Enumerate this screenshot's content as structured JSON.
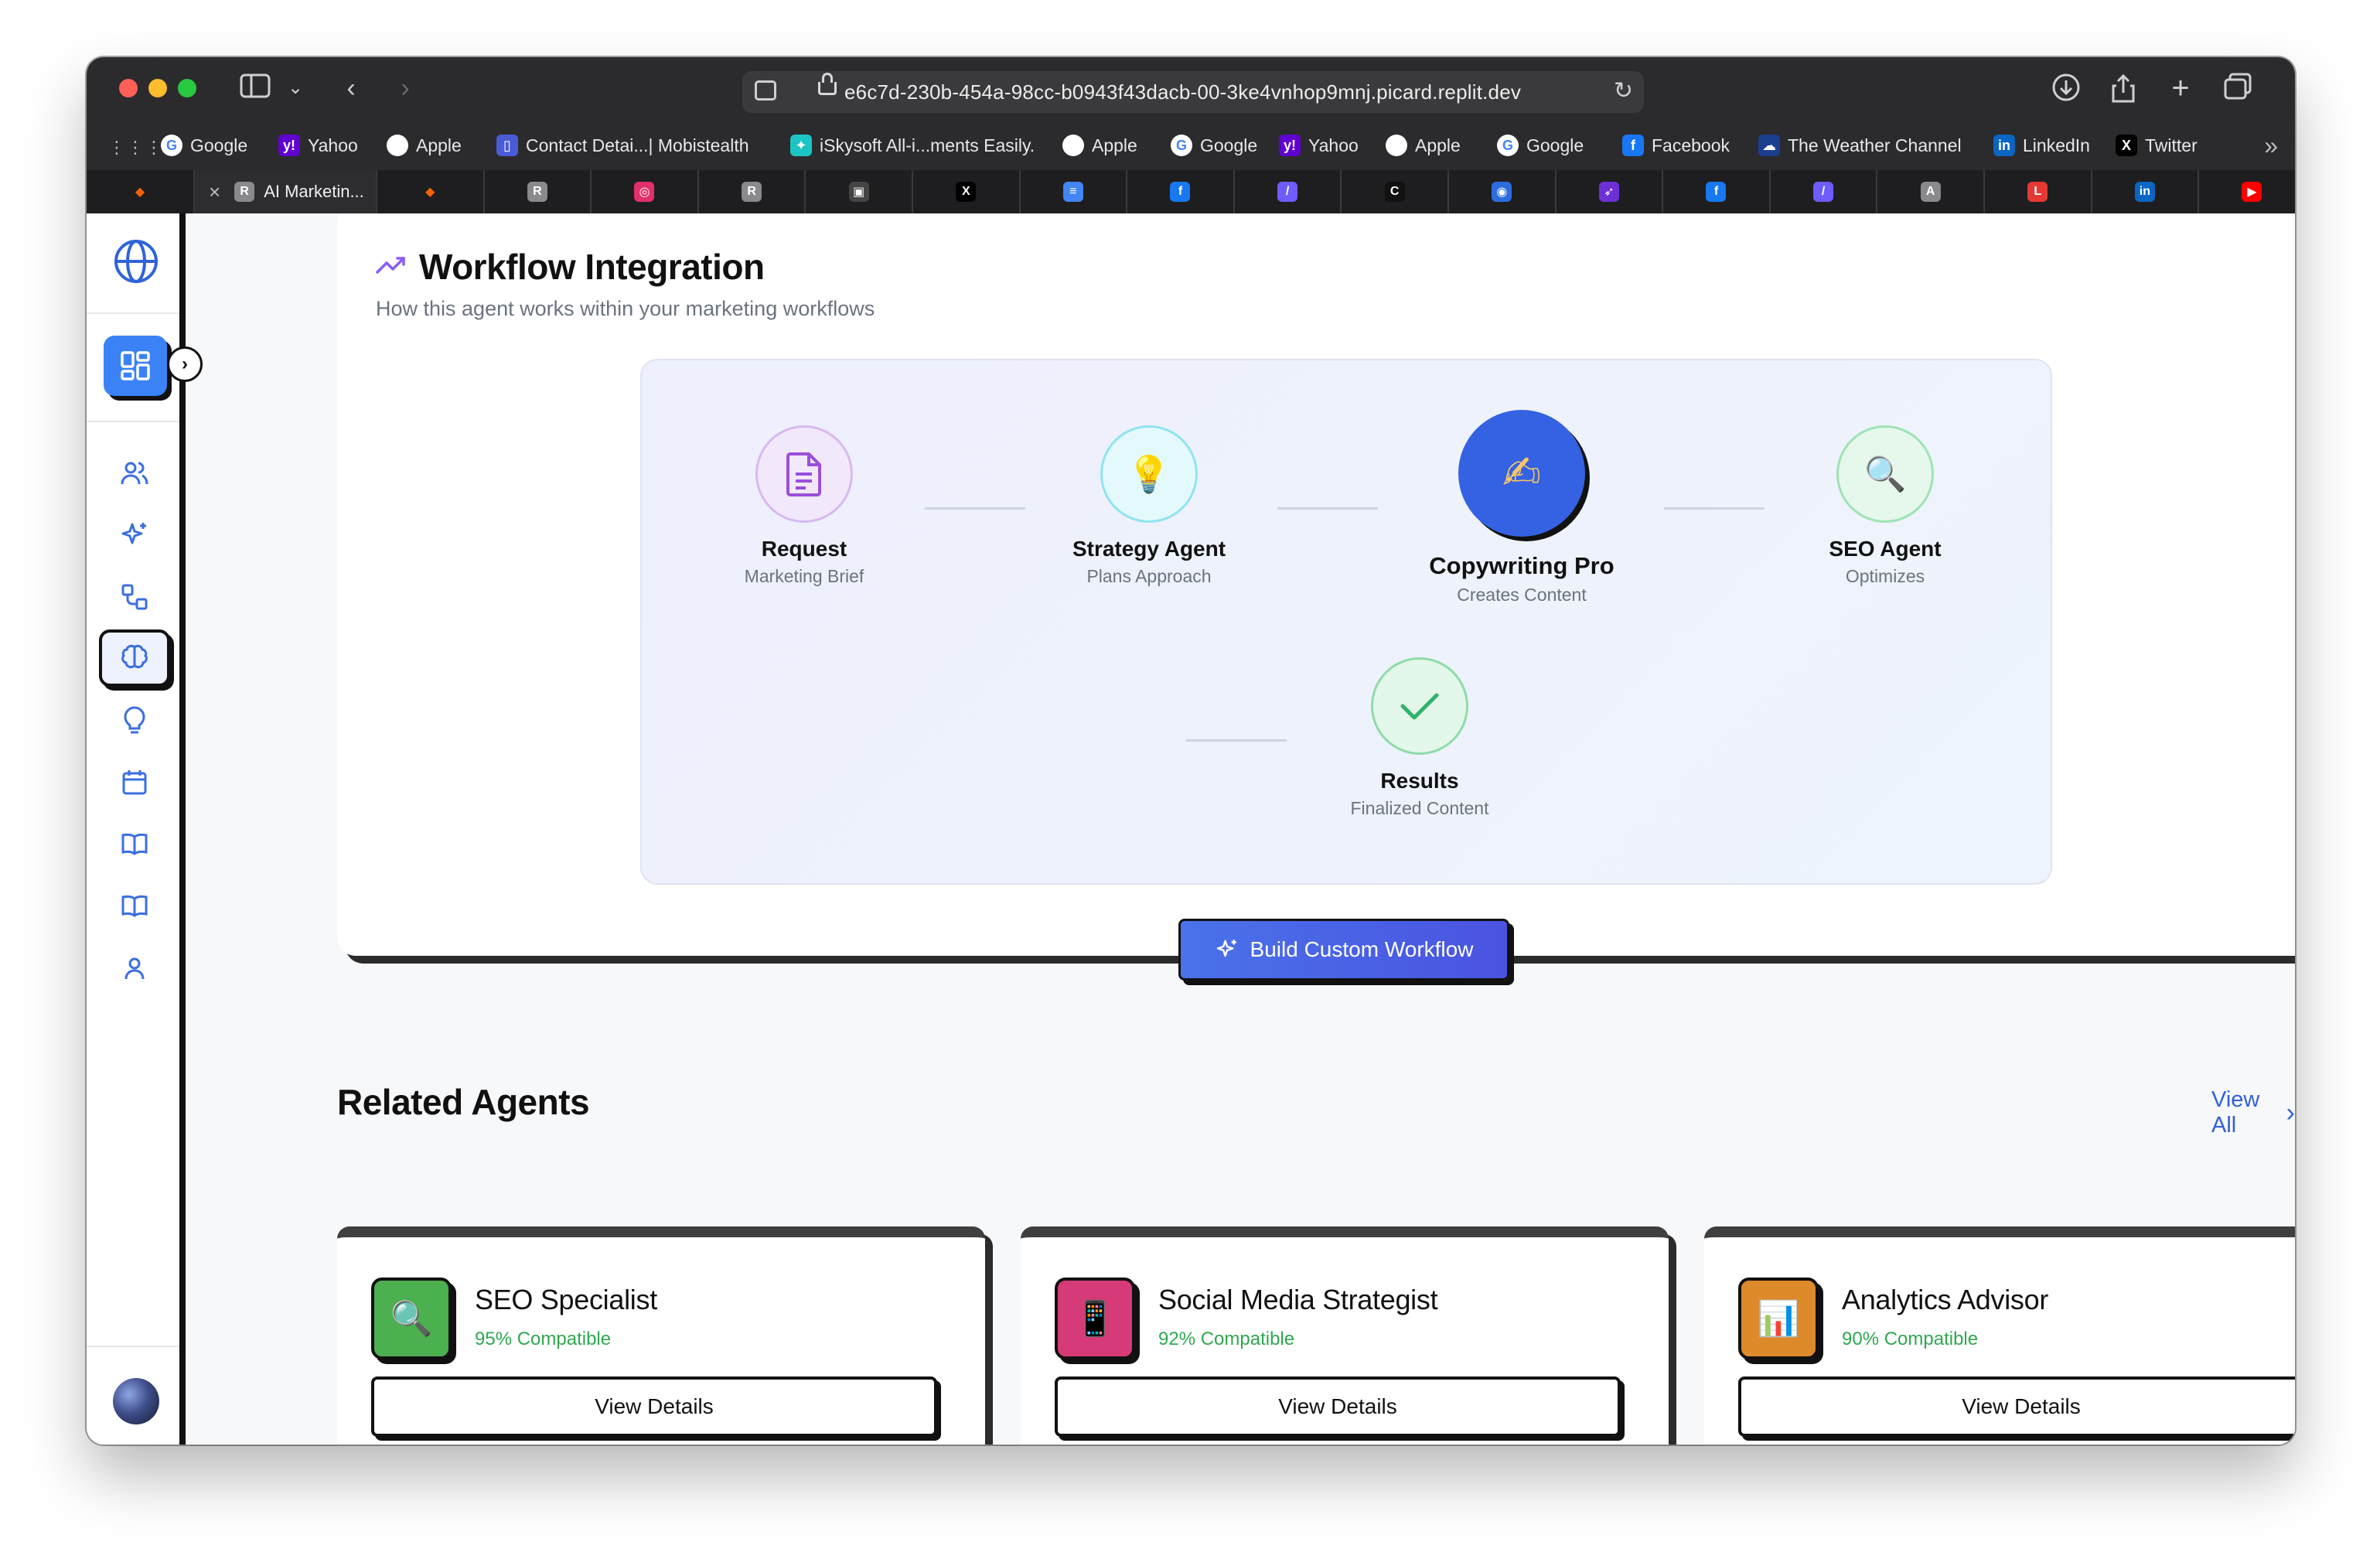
{
  "browser": {
    "url": "e6c7d-230b-454a-98cc-b0943f43dacb-00-3ke4vnhop9mnj.picard.replit.dev",
    "bookmarks": [
      {
        "label": "Google",
        "icon": "google-icon",
        "color": "#ffffff"
      },
      {
        "label": "Yahoo",
        "icon": "yahoo-icon",
        "color": "#6001d2"
      },
      {
        "label": "Apple",
        "icon": "apple-icon",
        "color": "#ffffff"
      },
      {
        "label": "Contact Detai...| Mobistealth",
        "icon": "phone-icon",
        "color": "#4b5bd6"
      },
      {
        "label": "iSkysoft All-i...ments Easily.",
        "icon": "bird-icon",
        "color": "#1dc4c4"
      },
      {
        "label": "Apple",
        "icon": "apple-icon",
        "color": "#ffffff"
      },
      {
        "label": "Google",
        "icon": "google-icon",
        "color": "#ffffff"
      },
      {
        "label": "Yahoo",
        "icon": "yahoo-icon",
        "color": "#6001d2"
      },
      {
        "label": "Apple",
        "icon": "apple-icon",
        "color": "#ffffff"
      },
      {
        "label": "Google",
        "icon": "google-icon",
        "color": "#ffffff"
      },
      {
        "label": "Facebook",
        "icon": "facebook-icon",
        "color": "#1877f2"
      },
      {
        "label": "The Weather Channel",
        "icon": "weather-icon",
        "color": "#1b3f8f"
      },
      {
        "label": "LinkedIn",
        "icon": "linkedin-icon",
        "color": "#0a66c2"
      },
      {
        "label": "Twitter",
        "icon": "x-icon",
        "color": "#000000"
      }
    ],
    "active_tab_title": "AI Marketin...",
    "tabs": [
      {
        "icon": "replit-icon",
        "color": "#f26207",
        "glyph": "◆"
      },
      {
        "icon": "replit-icon",
        "color": "#f26207",
        "glyph": "◆"
      },
      {
        "icon": "r-icon",
        "color": "#8a8a8e",
        "glyph": "R"
      },
      {
        "icon": "instagram-icon",
        "color": "#e1306c",
        "glyph": "◎"
      },
      {
        "icon": "r-icon",
        "color": "#8a8a8e",
        "glyph": "R"
      },
      {
        "icon": "game-icon",
        "color": "#444444",
        "glyph": "▣"
      },
      {
        "icon": "x-icon",
        "color": "#000000",
        "glyph": "X"
      },
      {
        "icon": "docs-icon",
        "color": "#4285f4",
        "glyph": "≡"
      },
      {
        "icon": "facebook-icon",
        "color": "#1877f2",
        "glyph": "f"
      },
      {
        "icon": "feather-icon",
        "color": "#6d5dfc",
        "glyph": "/"
      },
      {
        "icon": "c-icon",
        "color": "#111111",
        "glyph": "C"
      },
      {
        "icon": "search-circle-icon",
        "color": "#2d6cdf",
        "glyph": "◉"
      },
      {
        "icon": "rocket-icon",
        "color": "#6d2fd6",
        "glyph": "➶"
      },
      {
        "icon": "facebook-icon",
        "color": "#1877f2",
        "glyph": "f"
      },
      {
        "icon": "feather-icon",
        "color": "#6d5dfc",
        "glyph": "/"
      },
      {
        "icon": "a-icon",
        "color": "#8a8a8e",
        "glyph": "A"
      },
      {
        "icon": "l-icon",
        "color": "#e53935",
        "glyph": "L"
      },
      {
        "icon": "linkedin-icon",
        "color": "#0a66c2",
        "glyph": "in"
      },
      {
        "icon": "youtube-icon",
        "color": "#ff0000",
        "glyph": "▶"
      }
    ]
  },
  "sidebar": {
    "items": [
      {
        "icon": "users-icon"
      },
      {
        "icon": "sparkles-icon"
      },
      {
        "icon": "workflow-icon"
      },
      {
        "icon": "brain-icon",
        "active": true
      },
      {
        "icon": "lightbulb-icon"
      },
      {
        "icon": "calendar-icon"
      },
      {
        "icon": "book-icon"
      },
      {
        "icon": "book-open-icon"
      },
      {
        "icon": "user-icon"
      }
    ]
  },
  "workflow": {
    "title": "Workflow Integration",
    "subtitle": "How this agent works within your marketing workflows",
    "steps": [
      {
        "label": "Request",
        "sub": "Marketing Brief",
        "icon": "document-icon"
      },
      {
        "label": "Strategy Agent",
        "sub": "Plans Approach",
        "icon": "lightbulb-icon",
        "glyph": "💡"
      },
      {
        "label": "Copywriting Pro",
        "sub": "Creates Content",
        "icon": "writing-hand-icon",
        "glyph": "✍"
      },
      {
        "label": "SEO Agent",
        "sub": "Optimizes",
        "icon": "magnifier-icon",
        "glyph": "🔍"
      },
      {
        "label": "Results",
        "sub": "Finalized Content",
        "icon": "check-icon"
      }
    ],
    "build_button": "Build Custom Workflow"
  },
  "related": {
    "title": "Related Agents",
    "view_all": "View All",
    "agents": [
      {
        "name": "SEO Specialist",
        "compat": "95% Compatible",
        "button": "View Details",
        "icon": "magnifier-icon",
        "glyph": "🔍",
        "color": "#4caf50"
      },
      {
        "name": "Social Media Strategist",
        "compat": "92% Compatible",
        "button": "View Details",
        "icon": "mobile-phone-icon",
        "glyph": "📱",
        "color": "#d63a78"
      },
      {
        "name": "Analytics Advisor",
        "compat": "90% Compatible",
        "button": "View Details",
        "icon": "bar-chart-icon",
        "glyph": "📊",
        "color": "#dd8a2b"
      }
    ]
  },
  "colors": {
    "accent": "#3b82f6",
    "button": "#4a5be3",
    "compat": "#2fa84f",
    "link": "#3160d8"
  }
}
